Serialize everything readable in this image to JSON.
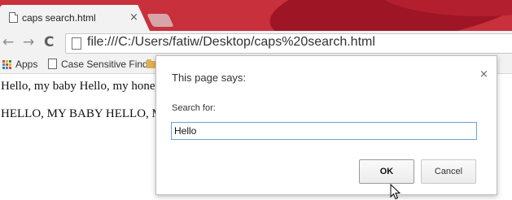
{
  "browser": {
    "tab": {
      "title": "caps search.html",
      "close_glyph": "×"
    },
    "toolbar": {
      "back_glyph": "←",
      "forward_glyph": "→",
      "reload_glyph": "C",
      "url": "file:///C:/Users/fatiw/Desktop/caps%20search.html"
    },
    "bookmarks": {
      "apps_label": "Apps",
      "items": [
        "Case Sensitive Find"
      ]
    },
    "colors": {
      "titlebar": "#c8303c",
      "accent_focus": "#6e9fdc"
    }
  },
  "page": {
    "paragraphs": [
      "Hello, my baby Hello, my honey",
      "HELLO, MY BABY HELLO, M"
    ]
  },
  "dialog": {
    "title": "This page says:",
    "close_glyph": "×",
    "prompt": "Search for:",
    "input_value": "Hello",
    "ok_label": "OK",
    "cancel_label": "Cancel"
  },
  "icons": {
    "tab": "page-icon",
    "omnibox": "page-icon",
    "apps": "apps-grid-icon",
    "bookmark_folder": "folder-icon",
    "cursor": "mouse-pointer-icon"
  }
}
